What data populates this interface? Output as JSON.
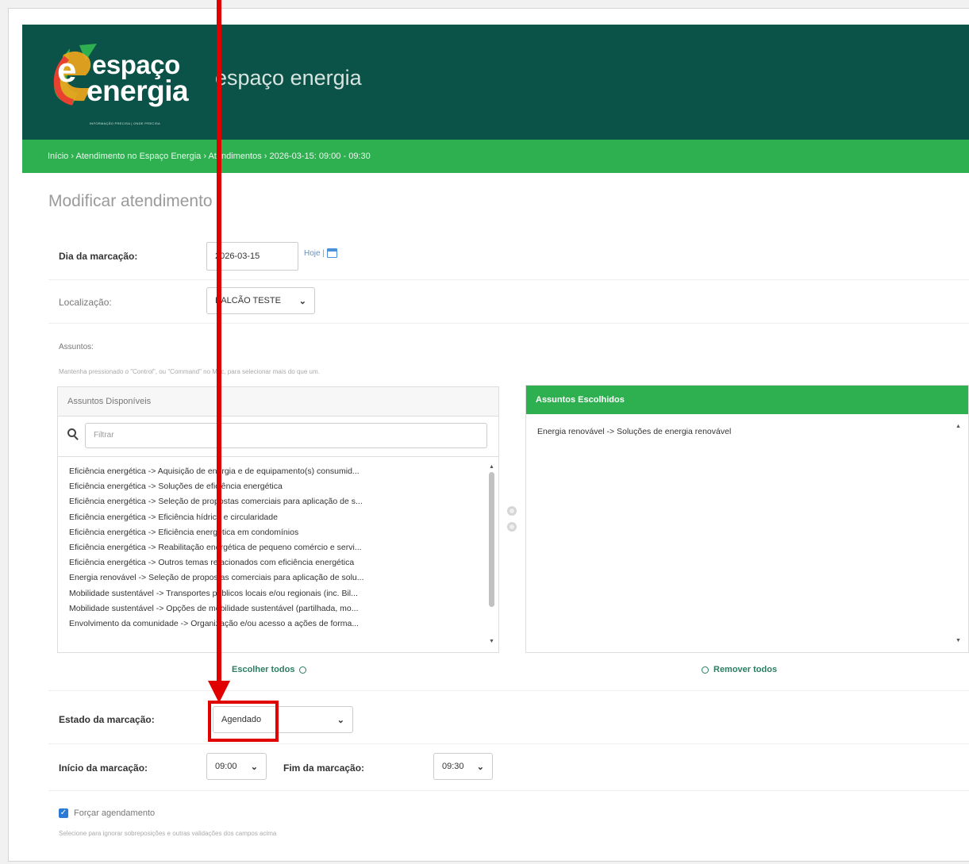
{
  "header": {
    "brand_line1": "espaço",
    "brand_line2": "energia",
    "brand_tagline": "INFORMAÇÃO PRECISA | ONDE PRECISA",
    "site_title": "espaço energia",
    "colors": {
      "header_bg": "#0b5248",
      "breadcrumb_bg": "#2fb050",
      "accent": "#2fb050",
      "annotation": "#e00000"
    }
  },
  "breadcrumbs": {
    "items": [
      "Início",
      "Atendimento no Espaço Energia",
      "Atendimentos",
      "2026-03-15: 09:00 - 09:30"
    ],
    "separator": "›"
  },
  "page_title": "Modificar atendimento",
  "form": {
    "date": {
      "label": "Dia da marcação:",
      "value": "2026-03-15",
      "today_link": "Hoje |",
      "icon": "calendar-icon"
    },
    "location": {
      "label": "Localização:",
      "value": "BALCÃO TESTE"
    },
    "subjects": {
      "label": "Assuntos:",
      "help": "Mantenha pressionado o \"Control\", ou \"Command\" no Mac, para selecionar mais do que um.",
      "available_title": "Assuntos Disponíveis",
      "filter_placeholder": "Filtrar",
      "available": [
        "Eficiência energética -> Aquisição de energia e de equipamento(s) consumid...",
        "Eficiência energética -> Soluções de eficiência energética",
        "Eficiência energética -> Seleção de propostas comerciais para aplicação de s...",
        "Eficiência energética -> Eficiência hídrica e circularidade",
        "Eficiência energética -> Eficiência energética em condomínios",
        "Eficiência energética -> Reabilitação energética de pequeno comércio e servi...",
        "Eficiência energética -> Outros temas relacionados com eficiência energética",
        "Energia renovável -> Seleção de propostas comerciais para aplicação de solu...",
        "Mobilidade sustentável -> Transportes públicos locais e/ou regionais (inc. Bil...",
        "Mobilidade sustentável -> Opções de mobilidade sustentável (partilhada, mo...",
        "Envolvimento da comunidade -> Organização e/ou acesso a ações de forma..."
      ],
      "chosen_title": "Assuntos Escolhidos",
      "chosen": [
        "Energia renovável -> Soluções de energia renovável"
      ],
      "choose_all": "Escolher todos",
      "remove_all": "Remover todos"
    },
    "state": {
      "label": "Estado da marcação:",
      "value": "Agendado"
    },
    "start": {
      "label": "Início da marcação:",
      "value": "09:00"
    },
    "end": {
      "label": "Fim da marcação:",
      "value": "09:30"
    },
    "force": {
      "label": "Forçar agendamento",
      "checked": true,
      "help": "Selecione para ignorar sobreposições e outras validações dos campos acima"
    }
  }
}
